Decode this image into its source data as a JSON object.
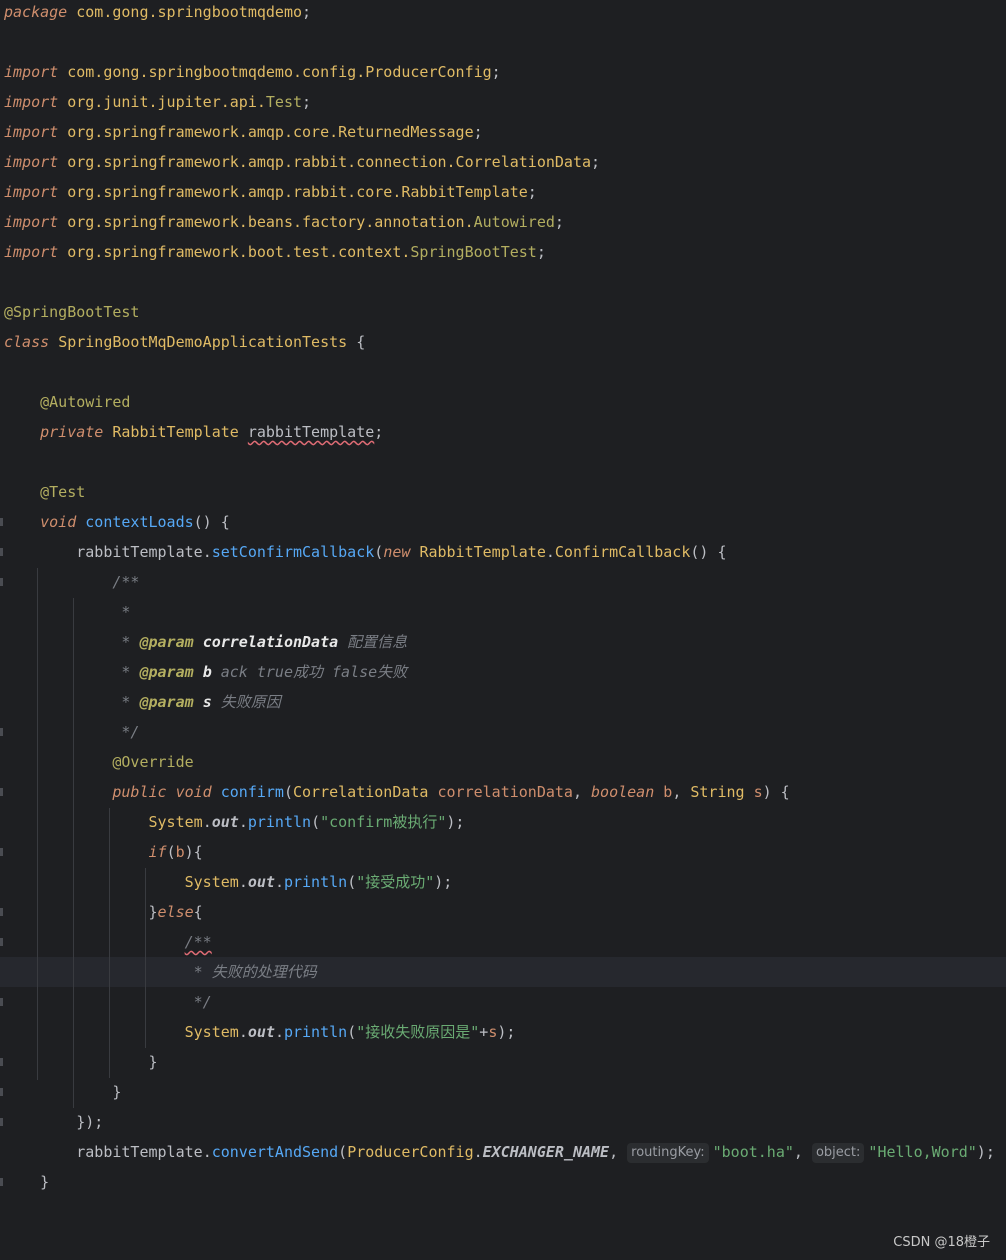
{
  "editor": {
    "lines": [
      [
        {
          "t": "package",
          "c": "kw"
        },
        {
          "t": " "
        },
        {
          "t": "com.gong.springbootmqdemo",
          "c": "pk"
        },
        {
          "t": ";"
        }
      ],
      [],
      [
        {
          "t": "import",
          "c": "kw"
        },
        {
          "t": " "
        },
        {
          "t": "com.gong.springbootmqdemo.config.ProducerConfig",
          "c": "pk"
        },
        {
          "t": ";"
        }
      ],
      [
        {
          "t": "import",
          "c": "kw"
        },
        {
          "t": " "
        },
        {
          "t": "org.junit.jupiter.api.",
          "c": "pk"
        },
        {
          "t": "Test",
          "c": "ann"
        },
        {
          "t": ";"
        }
      ],
      [
        {
          "t": "import",
          "c": "kw"
        },
        {
          "t": " "
        },
        {
          "t": "org.springframework.amqp.core.ReturnedMessage",
          "c": "pk"
        },
        {
          "t": ";"
        }
      ],
      [
        {
          "t": "import",
          "c": "kw"
        },
        {
          "t": " "
        },
        {
          "t": "org.springframework.amqp.rabbit.connection.CorrelationData",
          "c": "pk"
        },
        {
          "t": ";"
        }
      ],
      [
        {
          "t": "import",
          "c": "kw"
        },
        {
          "t": " "
        },
        {
          "t": "org.springframework.amqp.rabbit.core.RabbitTemplate",
          "c": "pk"
        },
        {
          "t": ";"
        }
      ],
      [
        {
          "t": "import",
          "c": "kw"
        },
        {
          "t": " "
        },
        {
          "t": "org.springframework.beans.factory.annotation.",
          "c": "pk"
        },
        {
          "t": "Autowired",
          "c": "ann"
        },
        {
          "t": ";"
        }
      ],
      [
        {
          "t": "import",
          "c": "kw"
        },
        {
          "t": " "
        },
        {
          "t": "org.springframework.boot.test.context.",
          "c": "pk"
        },
        {
          "t": "SpringBootTest",
          "c": "ann"
        },
        {
          "t": ";"
        }
      ],
      [],
      [
        {
          "t": "@SpringBootTest",
          "c": "ann"
        }
      ],
      [
        {
          "t": "class",
          "c": "kw"
        },
        {
          "t": " "
        },
        {
          "t": "SpringBootMqDemoApplicationTests",
          "c": "cls"
        },
        {
          "t": " {"
        }
      ],
      [],
      [
        {
          "t": "    "
        },
        {
          "t": "@Autowired",
          "c": "ann"
        }
      ],
      [
        {
          "t": "    "
        },
        {
          "t": "private",
          "c": "kw"
        },
        {
          "t": " "
        },
        {
          "t": "RabbitTemplate",
          "c": "cls"
        },
        {
          "t": " "
        },
        {
          "t": "rabbitTemplate",
          "c": "fld",
          "w": true
        },
        {
          "t": ";"
        }
      ],
      [],
      [
        {
          "t": "    "
        },
        {
          "t": "@Test",
          "c": "ann"
        }
      ],
      [
        {
          "t": "    "
        },
        {
          "t": "void",
          "c": "kw"
        },
        {
          "t": " "
        },
        {
          "t": "contextLoads",
          "c": "mth"
        },
        {
          "t": "() {"
        }
      ],
      [
        {
          "t": "        "
        },
        {
          "t": "rabbitTemplate",
          "c": "fld"
        },
        {
          "t": "."
        },
        {
          "t": "setConfirmCallback",
          "c": "mth"
        },
        {
          "t": "("
        },
        {
          "t": "new",
          "c": "kw"
        },
        {
          "t": " "
        },
        {
          "t": "RabbitTemplate",
          "c": "cls"
        },
        {
          "t": "."
        },
        {
          "t": "ConfirmCallback",
          "c": "cls"
        },
        {
          "t": "() {"
        }
      ],
      [
        {
          "t": "            "
        },
        {
          "t": "/**",
          "c": "cmt"
        }
      ],
      [
        {
          "t": "             "
        },
        {
          "t": "*",
          "c": "cmt"
        }
      ],
      [
        {
          "t": "             "
        },
        {
          "t": "* ",
          "c": "cmt"
        },
        {
          "t": "@param",
          "c": "dtag"
        },
        {
          "t": " "
        },
        {
          "t": "correlationData",
          "c": "dval"
        },
        {
          "t": " 配置信息",
          "c": "cmt"
        }
      ],
      [
        {
          "t": "             "
        },
        {
          "t": "* ",
          "c": "cmt"
        },
        {
          "t": "@param",
          "c": "dtag"
        },
        {
          "t": " "
        },
        {
          "t": "b",
          "c": "dval"
        },
        {
          "t": " ack true成功 false失败",
          "c": "cmt"
        }
      ],
      [
        {
          "t": "             "
        },
        {
          "t": "* ",
          "c": "cmt"
        },
        {
          "t": "@param",
          "c": "dtag"
        },
        {
          "t": " "
        },
        {
          "t": "s",
          "c": "dval"
        },
        {
          "t": " 失败原因",
          "c": "cmt"
        }
      ],
      [
        {
          "t": "             "
        },
        {
          "t": "*/",
          "c": "cmt"
        }
      ],
      [
        {
          "t": "            "
        },
        {
          "t": "@Override",
          "c": "ann"
        }
      ],
      [
        {
          "t": "            "
        },
        {
          "t": "public",
          "c": "kw"
        },
        {
          "t": " "
        },
        {
          "t": "void",
          "c": "kw"
        },
        {
          "t": " "
        },
        {
          "t": "confirm",
          "c": "mth"
        },
        {
          "t": "("
        },
        {
          "t": "CorrelationData",
          "c": "cls"
        },
        {
          "t": " "
        },
        {
          "t": "correlationData",
          "c": "prm"
        },
        {
          "t": ", "
        },
        {
          "t": "boolean",
          "c": "kw"
        },
        {
          "t": " "
        },
        {
          "t": "b",
          "c": "prm"
        },
        {
          "t": ", "
        },
        {
          "t": "String",
          "c": "cls"
        },
        {
          "t": " "
        },
        {
          "t": "s",
          "c": "prm"
        },
        {
          "t": ") {"
        }
      ],
      [
        {
          "t": "                "
        },
        {
          "t": "System",
          "c": "cls"
        },
        {
          "t": "."
        },
        {
          "t": "out",
          "c": "fldb"
        },
        {
          "t": "."
        },
        {
          "t": "println",
          "c": "mth"
        },
        {
          "t": "("
        },
        {
          "t": "\"confirm被执行\"",
          "c": "str"
        },
        {
          "t": ");"
        }
      ],
      [
        {
          "t": "                "
        },
        {
          "t": "if",
          "c": "kw"
        },
        {
          "t": "("
        },
        {
          "t": "b",
          "c": "prm"
        },
        {
          "t": "){"
        }
      ],
      [
        {
          "t": "                    "
        },
        {
          "t": "System",
          "c": "cls"
        },
        {
          "t": "."
        },
        {
          "t": "out",
          "c": "fldb"
        },
        {
          "t": "."
        },
        {
          "t": "println",
          "c": "mth"
        },
        {
          "t": "("
        },
        {
          "t": "\"接受成功\"",
          "c": "str"
        },
        {
          "t": ");"
        }
      ],
      [
        {
          "t": "                "
        },
        {
          "t": "}"
        },
        {
          "t": "else",
          "c": "kw"
        },
        {
          "t": "{"
        }
      ],
      [
        {
          "t": "                    "
        },
        {
          "t": "/**",
          "c": "cmt",
          "w": true
        }
      ],
      [
        {
          "t": "                     "
        },
        {
          "t": "* 失败的处理代码",
          "c": "cmt"
        }
      ],
      [
        {
          "t": "                     "
        },
        {
          "t": "*/",
          "c": "cmt"
        }
      ],
      [
        {
          "t": "                    "
        },
        {
          "t": "System",
          "c": "cls"
        },
        {
          "t": "."
        },
        {
          "t": "out",
          "c": "fldb"
        },
        {
          "t": "."
        },
        {
          "t": "println",
          "c": "mth"
        },
        {
          "t": "("
        },
        {
          "t": "\"接收失败原因是\"",
          "c": "str"
        },
        {
          "t": "+"
        },
        {
          "t": "s",
          "c": "prm"
        },
        {
          "t": ");"
        }
      ],
      [
        {
          "t": "                "
        },
        {
          "t": "}"
        }
      ],
      [
        {
          "t": "            "
        },
        {
          "t": "}"
        }
      ],
      [
        {
          "t": "        "
        },
        {
          "t": "});"
        }
      ],
      [
        {
          "t": "        "
        },
        {
          "t": "rabbitTemplate",
          "c": "fld"
        },
        {
          "t": "."
        },
        {
          "t": "convertAndSend",
          "c": "mth"
        },
        {
          "t": "("
        },
        {
          "t": "ProducerConfig",
          "c": "cls"
        },
        {
          "t": "."
        },
        {
          "t": "EXCHANGER_NAME",
          "c": "fldb"
        },
        {
          "t": ", "
        },
        {
          "t": "routingKey:",
          "h": true
        },
        {
          "t": "\"boot.ha\"",
          "c": "str"
        },
        {
          "t": ", "
        },
        {
          "t": "object:",
          "h": true
        },
        {
          "t": "\"Hello,Word\"",
          "c": "str"
        },
        {
          "t": ");"
        }
      ],
      [
        {
          "t": "    "
        },
        {
          "t": "}"
        }
      ]
    ]
  },
  "watermark": "CSDN @18橙子"
}
